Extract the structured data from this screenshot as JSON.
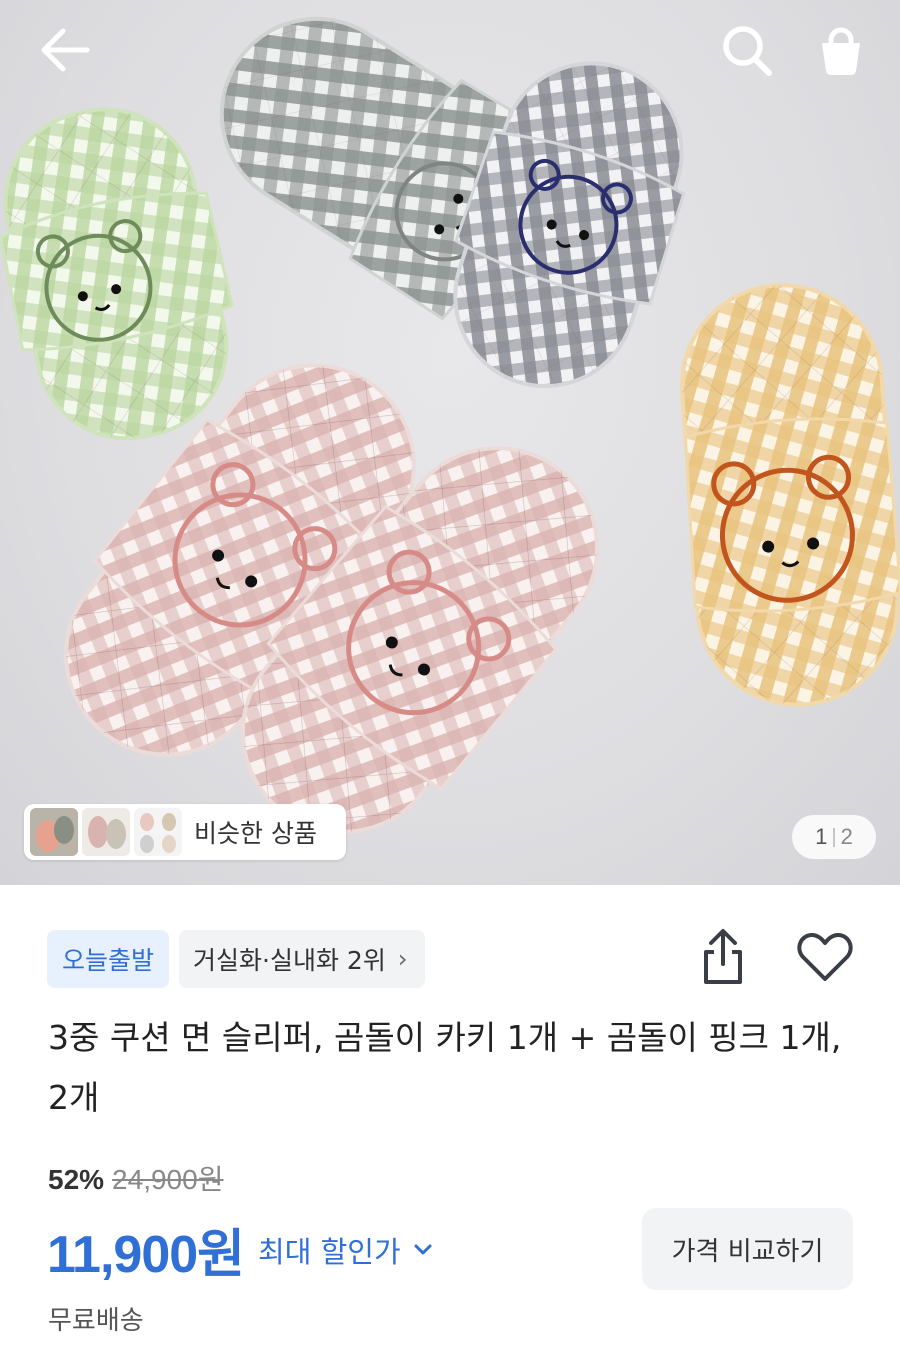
{
  "header": {
    "back_icon": "arrow-left-icon",
    "search_icon": "search-icon",
    "cart_icon": "shopping-bag-icon"
  },
  "gallery": {
    "similar_label": "비슷한 상품",
    "page_current": "1",
    "page_total": "2"
  },
  "badges": {
    "today_ship": "오늘출발",
    "rank": "거실화·실내화 2위",
    "rank_chevron": "›"
  },
  "product": {
    "title": "3중 쿠션 면 슬리퍼, 곰돌이 카키 1개 + 곰돌이 핑크 1개, 2개",
    "discount_rate": "52%",
    "original_price": "24,900원",
    "price": "11,900원",
    "max_discount_label": "최대 할인가",
    "max_discount_chevron": "⌄",
    "compare_button": "가격 비교하기",
    "shipping": "무료배송"
  },
  "colors": {
    "accent_blue": "#2f6fd6",
    "badge_blue_bg": "#e7f0fd",
    "gray_bg": "#f2f3f5"
  }
}
